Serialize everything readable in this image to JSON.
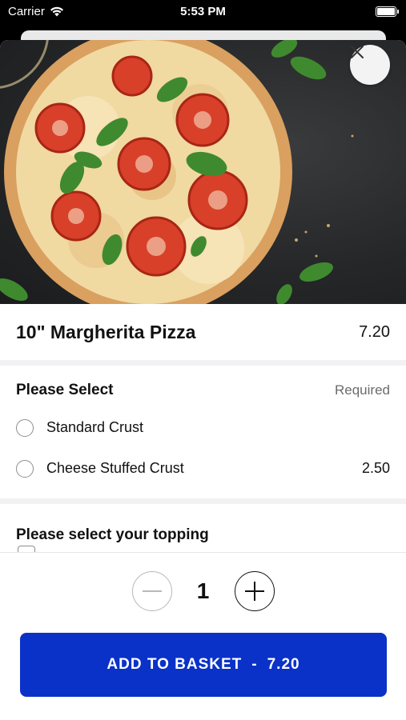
{
  "status_bar": {
    "carrier": "Carrier",
    "time": "5:53 PM"
  },
  "item": {
    "name": "10\" Margherita Pizza",
    "price": "7.20"
  },
  "crust_group": {
    "label": "Please Select",
    "required_text": "Required",
    "options": [
      {
        "label": "Standard Crust",
        "price": ""
      },
      {
        "label": "Cheese Stuffed Crust",
        "price": "2.50"
      }
    ]
  },
  "topping_group": {
    "label": "Please select your topping"
  },
  "quantity": "1",
  "add_button": {
    "label": "ADD TO BASKET",
    "separator": "-",
    "price": "7.20"
  },
  "colors": {
    "accent": "#0a32c8",
    "background_dark": "#000000"
  },
  "icons": {
    "close": "close-icon",
    "minus": "minus-circle-icon",
    "plus": "plus-circle-icon",
    "wifi": "wifi-icon",
    "battery": "battery-icon"
  }
}
